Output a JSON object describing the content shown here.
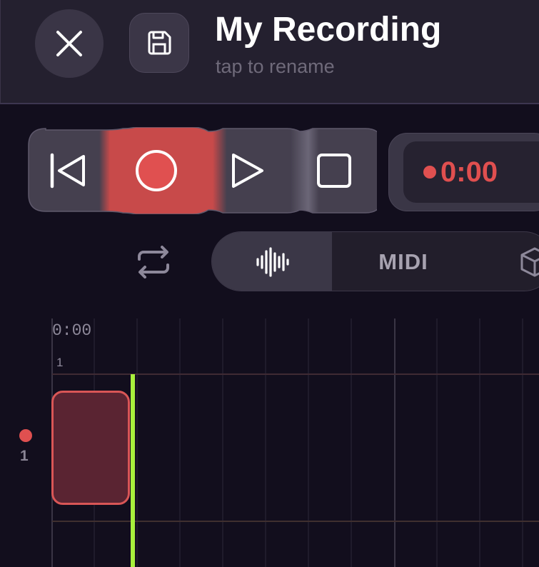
{
  "header": {
    "title": "My Recording",
    "subtitle": "tap to rename"
  },
  "icons": {
    "close": "close-icon",
    "save": "floppy-disk-icon",
    "skip_back": "skip-to-start-icon",
    "record": "record-icon",
    "play": "play-icon",
    "stop": "stop-icon",
    "loop": "loop-icon",
    "audio": "waveform-icon",
    "cube": "cube-icon"
  },
  "timer": {
    "value": "0:00"
  },
  "modes": {
    "midi_label": "MIDI"
  },
  "timeline": {
    "ruler_time": "0:00",
    "ruler_bar": "1",
    "tracks": [
      {
        "number": "1",
        "armed": true
      }
    ]
  },
  "colors": {
    "record": "#e05050",
    "playhead": "#a8f03c",
    "background": "#120e1d"
  }
}
